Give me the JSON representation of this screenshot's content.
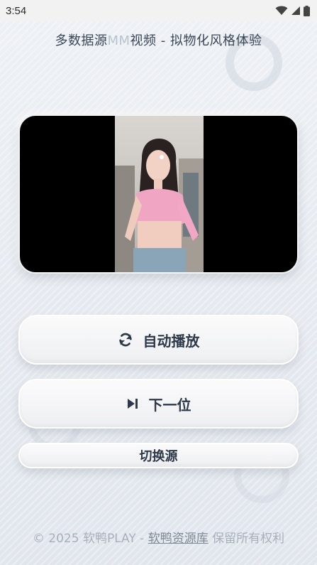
{
  "status_bar": {
    "time": "3:54",
    "icons": [
      "wifi-icon",
      "signal-icon",
      "battery-icon"
    ]
  },
  "header": {
    "title_before": "多数据源",
    "title_mm": "MM",
    "title_after": "视频 - 拟物化风格体验"
  },
  "player": {
    "content": "video-frame"
  },
  "buttons": {
    "auto_play": {
      "label": "自动播放",
      "icon": "refresh-icon"
    },
    "next": {
      "label": "下一位",
      "icon": "skip-next-icon"
    },
    "switch_source": {
      "label": "切换源"
    }
  },
  "footer": {
    "prefix": "© 2025 软鸭PLAY - ",
    "link": "软鸭资源库",
    "suffix": " 保留所有权利"
  },
  "colors": {
    "background": "#e6eaf0",
    "text": "#2d3848",
    "footer_text": "#a8b0bb"
  }
}
